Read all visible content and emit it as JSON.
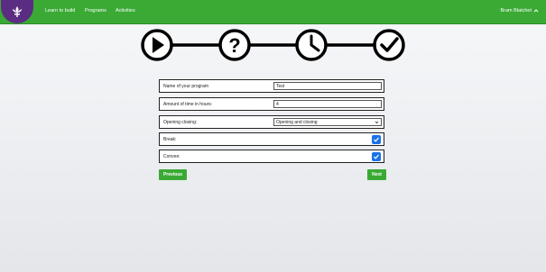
{
  "navbar": {
    "logo_icon": "fleur-de-lis-icon",
    "links": [
      "Learn to build",
      "Programs",
      "Activities"
    ],
    "user_name": "Bram Blatchet",
    "user_menu_icon": "chevron-up-icon",
    "color": "#3aaa35"
  },
  "stepper": {
    "steps": [
      "play-icon",
      "question-mark-icon",
      "clock-icon",
      "checkmark-icon"
    ]
  },
  "form": {
    "program_name": {
      "label": "Name of your program",
      "value": "Test"
    },
    "hours": {
      "label": "Amount of time in hours:",
      "value": "4"
    },
    "opening_closing": {
      "label": "Opening closing:",
      "selected": "Opening and closing"
    },
    "break": {
      "label": "Break:",
      "checked": true
    },
    "convee": {
      "label": "Convee:",
      "checked": true
    }
  },
  "buttons": {
    "previous": "Previous",
    "next": "Next"
  }
}
